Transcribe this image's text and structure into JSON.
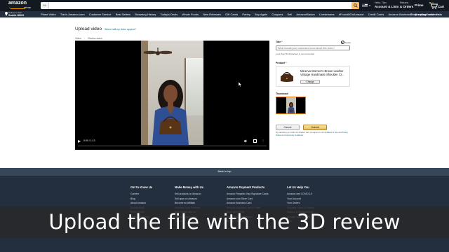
{
  "header": {
    "logo_text": "amazon",
    "logo_sub": "prime",
    "search_dept": "All",
    "search_placeholder": "",
    "account_hello": "Hello, Tian",
    "account_label": "Account & Lists",
    "orders_small": "Returns",
    "orders_label": "& Orders",
    "prime_label": "Prime",
    "cart_count": "0",
    "cart_label": "Cart"
  },
  "nav": {
    "deliver_line1": "Deliver to Tian",
    "deliver_line2": "Seattle 98109",
    "links": [
      "Prime Video",
      "Tian's Amazon.com",
      "Customer Service",
      "Best Sellers",
      "Browsing History",
      "Today's Deals",
      "Whole Foods",
      "New Releases",
      "Gift Cards",
      "Pantry",
      "Buy Again",
      "Coupons",
      "Sell",
      "AmazonBasics",
      "Livestreams",
      "#FoundItOnAmazon",
      "Credit Cards",
      "Amazon Business",
      "Shopper Toolkit"
    ],
    "right_promo": "Shop college essentials"
  },
  "page": {
    "title": "Upload video",
    "title_link": "Where will my video appear?",
    "breadcrumb": [
      "Video",
      "Review video"
    ]
  },
  "player": {
    "time": "0:00 / 1:13",
    "progress": 0.0,
    "more": "⋮"
  },
  "form": {
    "title_label": "Title",
    "required_mark": "*",
    "help_text": "Guide",
    "title_placeholder": "What should your customers know about this video?",
    "title_hint": "Less than 60 characters is recommended",
    "product_label": "Product",
    "product_name": "Minerva Women's Brown Leather Vintage Handmade Shoulder Cr...",
    "change_button": "Change",
    "thumbnail_label": "Thumbnail",
    "cancel_button": "Cancel",
    "submit_button": "Submit",
    "legal_prefix": "By submitting your video for Amazon use, you agree to our",
    "legal_link1": "Conditions of Use",
    "legal_mid": "and",
    "legal_link2": "Privacy Notice",
    "legal_and": "and",
    "legal_link3": "Community Guidelines"
  },
  "footer": {
    "back_to_top": "Back to top",
    "columns": [
      {
        "heading": "Get to Know Us",
        "items": [
          "Careers",
          "Blog",
          "About Amazon",
          "Sustainability",
          "Press Center",
          "Investor Relations",
          "Amazon Devices"
        ]
      },
      {
        "heading": "Make Money with Us",
        "items": [
          "Sell products on Amazon",
          "Sell apps on Amazon",
          "Become an Affiliate",
          "Advertise Your Products",
          "Self-Publish with Us",
          "Host an Amazon Hub",
          "See More"
        ]
      },
      {
        "heading": "Amazon Payment Products",
        "items": [
          "Amazon Rewards Visa Signature Cards",
          "Amazon.com Store Card",
          "Amazon Business Card",
          "Amazon Business Line of Credit",
          "Shop with Points",
          "Credit Card Marketplace",
          "Reload Your Balance"
        ]
      },
      {
        "heading": "Let Us Help You",
        "items": [
          "Amazon and COVID-19",
          "Your Account",
          "Your Orders",
          "Shipping Rates & Policies",
          "Returns & Replacements",
          "Manage Your Content",
          "Help"
        ]
      }
    ]
  },
  "caption": "Upload the file with the 3D review",
  "colors": {
    "header_bg": "#131921",
    "nav_bg": "#232f3e",
    "footer_bg": "#232f3e",
    "backtop_bg": "#37475a",
    "submit_yellow": "#f0c14b",
    "accent_orange": "#ff9900",
    "link_teal": "#007185"
  }
}
